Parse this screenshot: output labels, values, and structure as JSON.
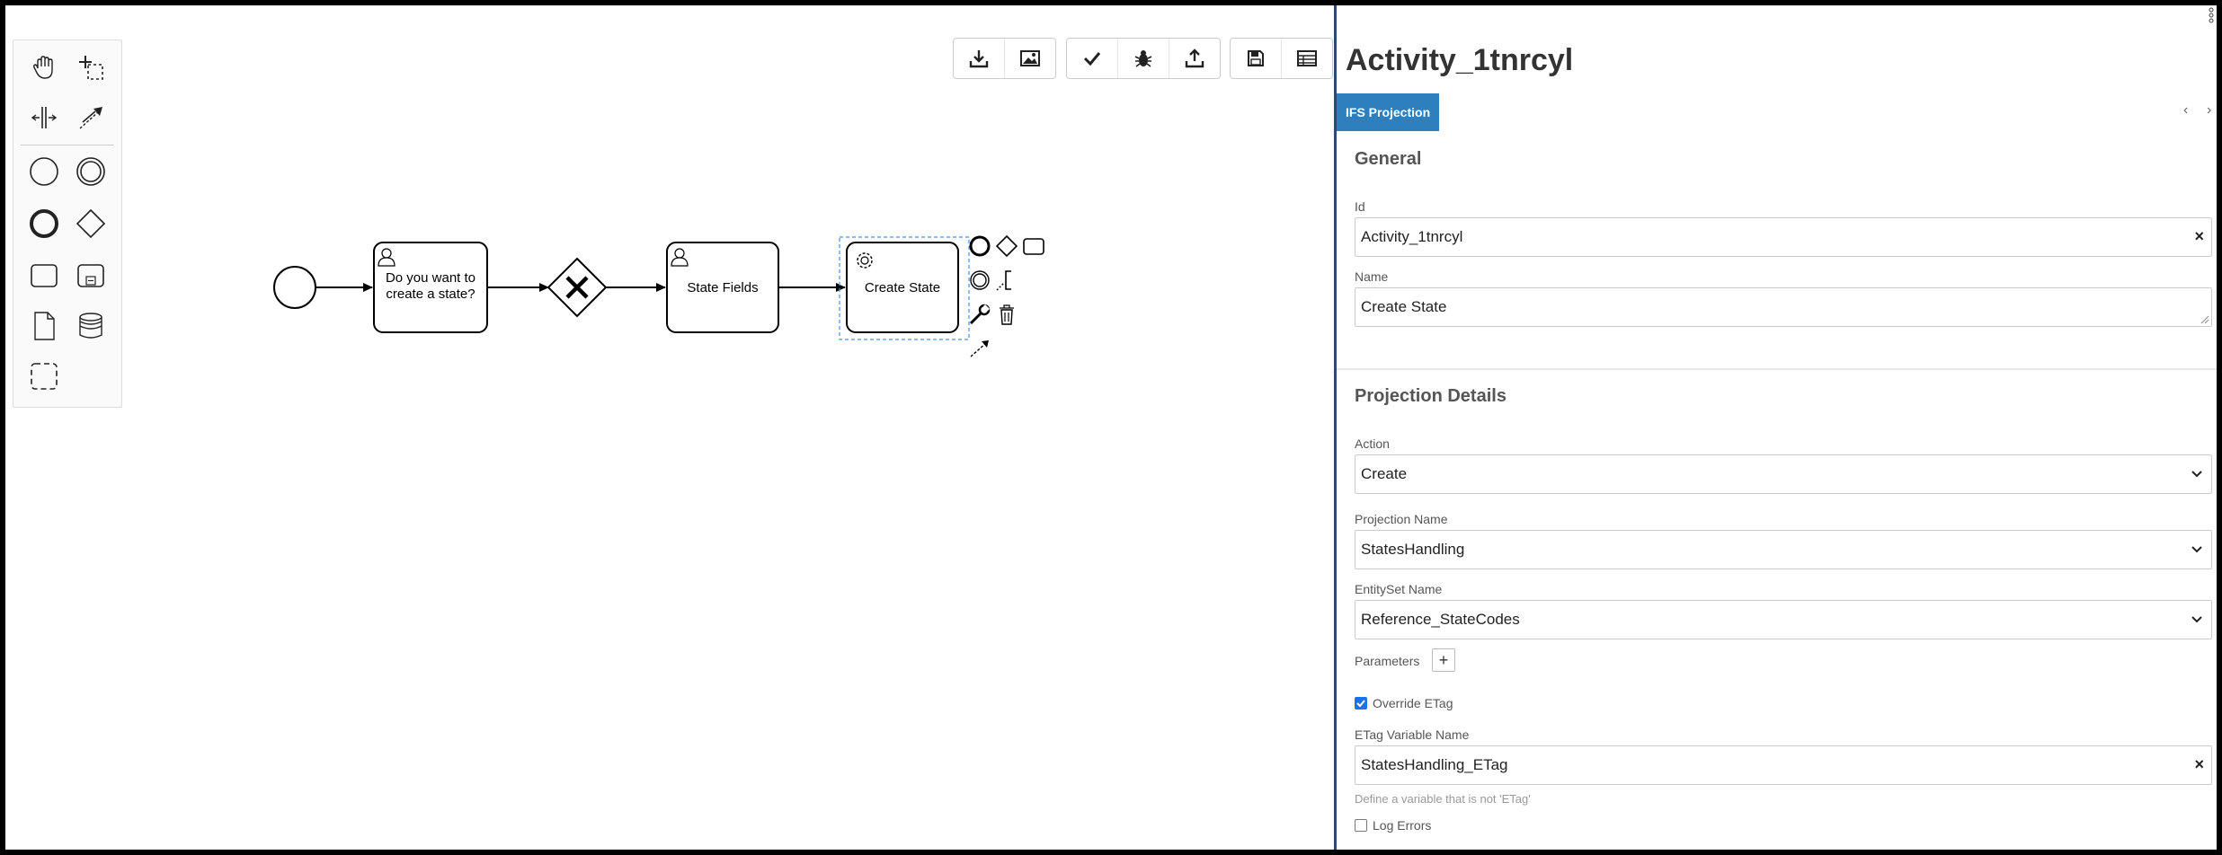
{
  "palette": {
    "tools": [
      "hand-tool",
      "lasso-tool",
      "space-tool",
      "global-connect-tool"
    ],
    "elements": [
      "start-event",
      "intermediate-event",
      "end-event",
      "gateway",
      "task",
      "subprocess",
      "data-object",
      "data-store",
      "group"
    ]
  },
  "toolbar": {
    "groups": [
      [
        "download-icon",
        "image-icon"
      ],
      [
        "check-icon",
        "bug-icon",
        "upload-icon"
      ],
      [
        "save-icon",
        "table-icon"
      ]
    ]
  },
  "diagram": {
    "task1_line1": "Do you want to",
    "task1_line2": "create a state?",
    "task2": "State Fields",
    "task3": "Create State"
  },
  "panel": {
    "title": "Activity_1tnrcyl",
    "tab": "IFS Projection",
    "general": {
      "title": "General",
      "id_label": "Id",
      "id_value": "Activity_1tnrcyl",
      "name_label": "Name",
      "name_value": "Create State"
    },
    "projection": {
      "title": "Projection Details",
      "action_label": "Action",
      "action_value": "Create",
      "projection_name_label": "Projection Name",
      "projection_name_value": "StatesHandling",
      "entityset_label": "EntitySet Name",
      "entityset_value": "Reference_StateCodes",
      "parameters_label": "Parameters",
      "parameters_add": "+",
      "override_etag_label": "Override ETag",
      "override_etag_checked": true,
      "etag_var_label": "ETag Variable Name",
      "etag_var_value": "StatesHandling_ETag",
      "etag_hint": "Define a variable that is not 'ETag'",
      "log_errors_label": "Log Errors",
      "log_errors_checked": false
    },
    "clear_glyph": "×",
    "prev_glyph": "‹",
    "next_glyph": "›"
  }
}
